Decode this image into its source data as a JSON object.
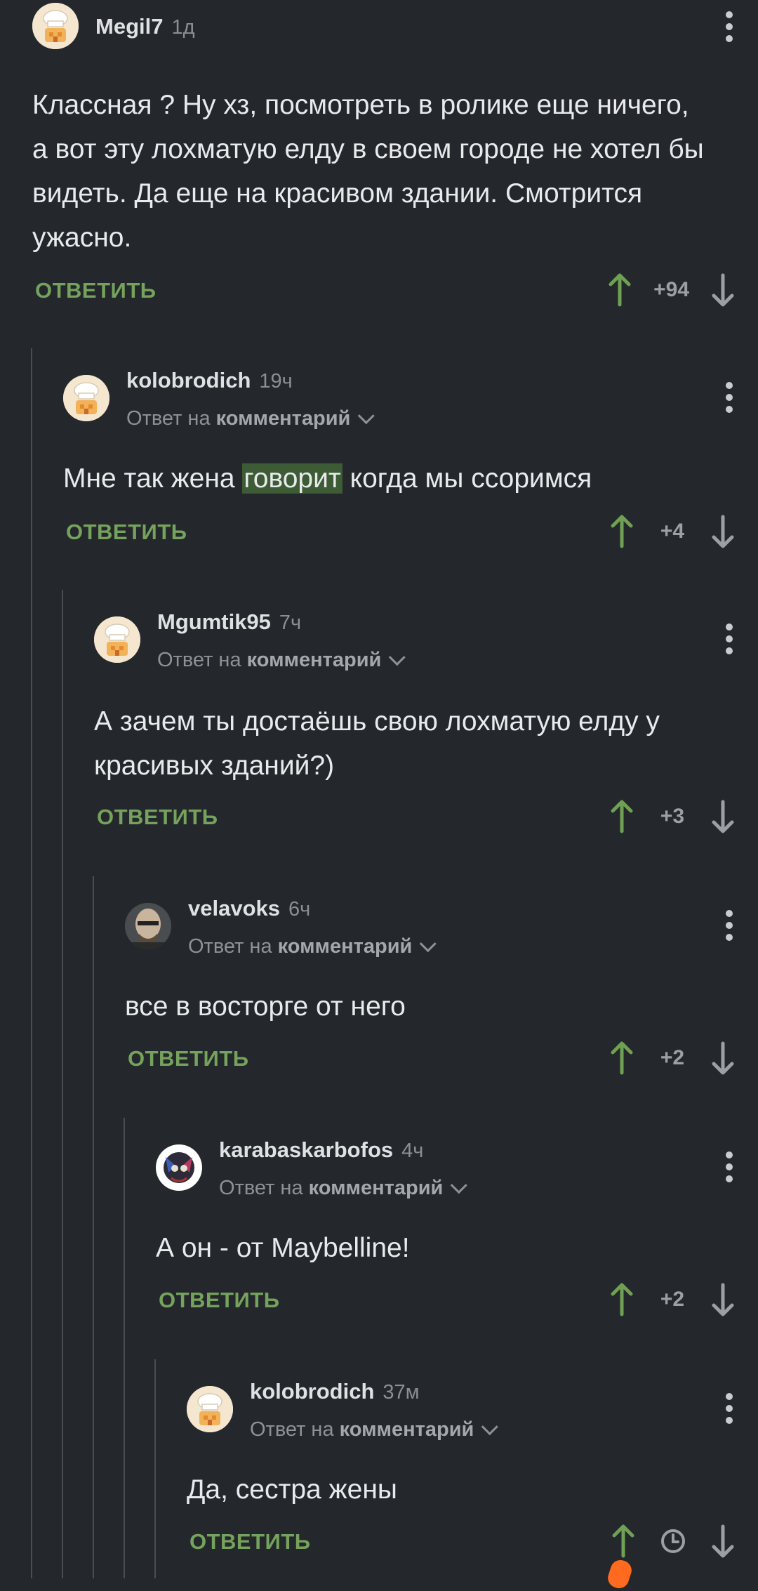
{
  "reply_label": "ОТВЕТИТЬ",
  "reply_to_prefix": "Ответ на",
  "reply_to_target": "комментарий",
  "colors": {
    "background": "#24272b",
    "reply": "#75a25c",
    "upvote": "#6fa053",
    "highlight": "#3d5b34"
  },
  "comments": [
    {
      "author": "Megil7",
      "time": "1д",
      "avatar": "chef-hat-icon",
      "text": "Классная ? Ну хз, посмотреть в ролике еще ничего, а вот эту лохматую елду в своем городе не хотел бы видеть. Да еще на красивом здании. Смотрится ужасно.",
      "score": "+94"
    },
    {
      "author": "kolobrodich",
      "time": "19ч",
      "avatar": "chef-hat-icon",
      "text_before": "Мне так жена ",
      "text_highlight": "говорит",
      "text_after": " когда мы ссоримся",
      "score": "+4"
    },
    {
      "author": "Mgumtik95",
      "time": "7ч",
      "avatar": "chef-hat-icon",
      "text": "А зачем ты достаёшь свою лохматую елду у красивых зданий?)",
      "score": "+3"
    },
    {
      "author": "velavoks",
      "time": "6ч",
      "avatar": "bald-man-avatar",
      "text": "все в восторге от него",
      "score": "+2"
    },
    {
      "author": "karabaskarbofos",
      "time": "4ч",
      "avatar": "cartoon-avatar",
      "text": "А он - от Maybelline!",
      "score": "+2"
    },
    {
      "author": "kolobrodich",
      "time": "37м",
      "avatar": "chef-hat-icon",
      "text": "Да, сестра жены",
      "score_icon": "clock-icon"
    }
  ]
}
